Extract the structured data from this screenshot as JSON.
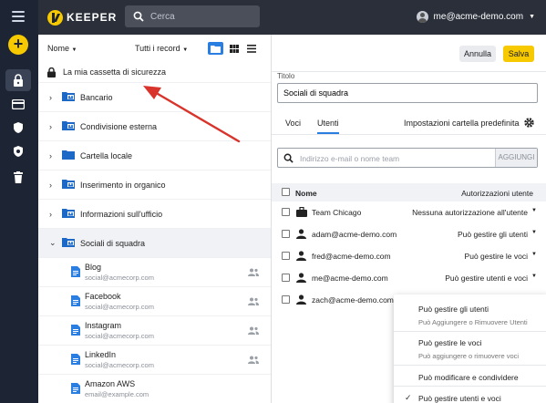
{
  "app": {
    "brand": "KEEPER"
  },
  "search": {
    "placeholder": "Cerca"
  },
  "user": {
    "email": "me@acme-demo.com"
  },
  "colors": {
    "accent": "#2a7de1",
    "brand_yellow": "#f7c900",
    "rail": "#1d2433",
    "topbar": "#2a2f3a",
    "arrow": "#d9342b"
  },
  "rail": {
    "icons": [
      "menu-icon",
      "add-icon",
      "vault-lock-icon",
      "card-icon",
      "shield-icon",
      "breachwatch-icon",
      "trash-icon"
    ]
  },
  "left": {
    "sort_label": "Nome",
    "filter_label": "Tutti i record",
    "vault_label": "La mia cassetta di sicurezza",
    "folders": [
      {
        "label": "Bancario",
        "shared": true
      },
      {
        "label": "Condivisione esterna",
        "shared": true
      },
      {
        "label": "Cartella locale",
        "shared": false
      },
      {
        "label": "Inserimento in organico",
        "shared": true
      },
      {
        "label": "Informazioni sull'ufficio",
        "shared": true
      },
      {
        "label": "Sociali di squadra",
        "shared": true,
        "expanded": true
      }
    ],
    "records": [
      {
        "title": "Blog",
        "sub": "social@acmecorp.com"
      },
      {
        "title": "Facebook",
        "sub": "social@acmecorp.com"
      },
      {
        "title": "Instagram",
        "sub": "social@acmecorp.com"
      },
      {
        "title": "LinkedIn",
        "sub": "social@acmecorp.com"
      },
      {
        "title": "Amazon AWS",
        "sub": "email@example.com"
      }
    ]
  },
  "right": {
    "cancel_label": "Annulla",
    "save_label": "Salva",
    "title_label": "Titolo",
    "title_value": "Sociali di squadra",
    "tabs": [
      "Voci",
      "Utenti"
    ],
    "active_tab": "Utenti",
    "default_settings_label": "Impostazioni cartella predefinita",
    "add_placeholder": "Indirizzo e-mail o nome team",
    "add_button": "AGGIUNGI",
    "col_name": "Nome",
    "col_perm": "Autorizzazioni utente",
    "users": [
      {
        "name": "Team Chicago",
        "perm": "Nessuna autorizzazione all'utente",
        "type": "team"
      },
      {
        "name": "adam@acme-demo.com",
        "perm": "Può gestire gli utenti",
        "type": "user"
      },
      {
        "name": "fred@acme-demo.com",
        "perm": "Può gestire le voci",
        "type": "user"
      },
      {
        "name": "me@acme-demo.com",
        "perm": "Può gestire utenti e voci",
        "type": "user"
      },
      {
        "name": "zach@acme-demo.com",
        "perm": "",
        "type": "user"
      }
    ]
  },
  "dropdown": {
    "options": [
      {
        "label": "Può gestire gli utenti",
        "sub": "Può Aggiungere o Rimuovere Utenti"
      },
      {
        "label": "Può gestire le voci",
        "sub": "Può aggiungere o rimuovere voci"
      },
      {
        "label": "Può modificare e condividere",
        "sub": ""
      },
      {
        "label": "Può gestire utenti e voci",
        "sub": "",
        "checked": true
      }
    ]
  }
}
